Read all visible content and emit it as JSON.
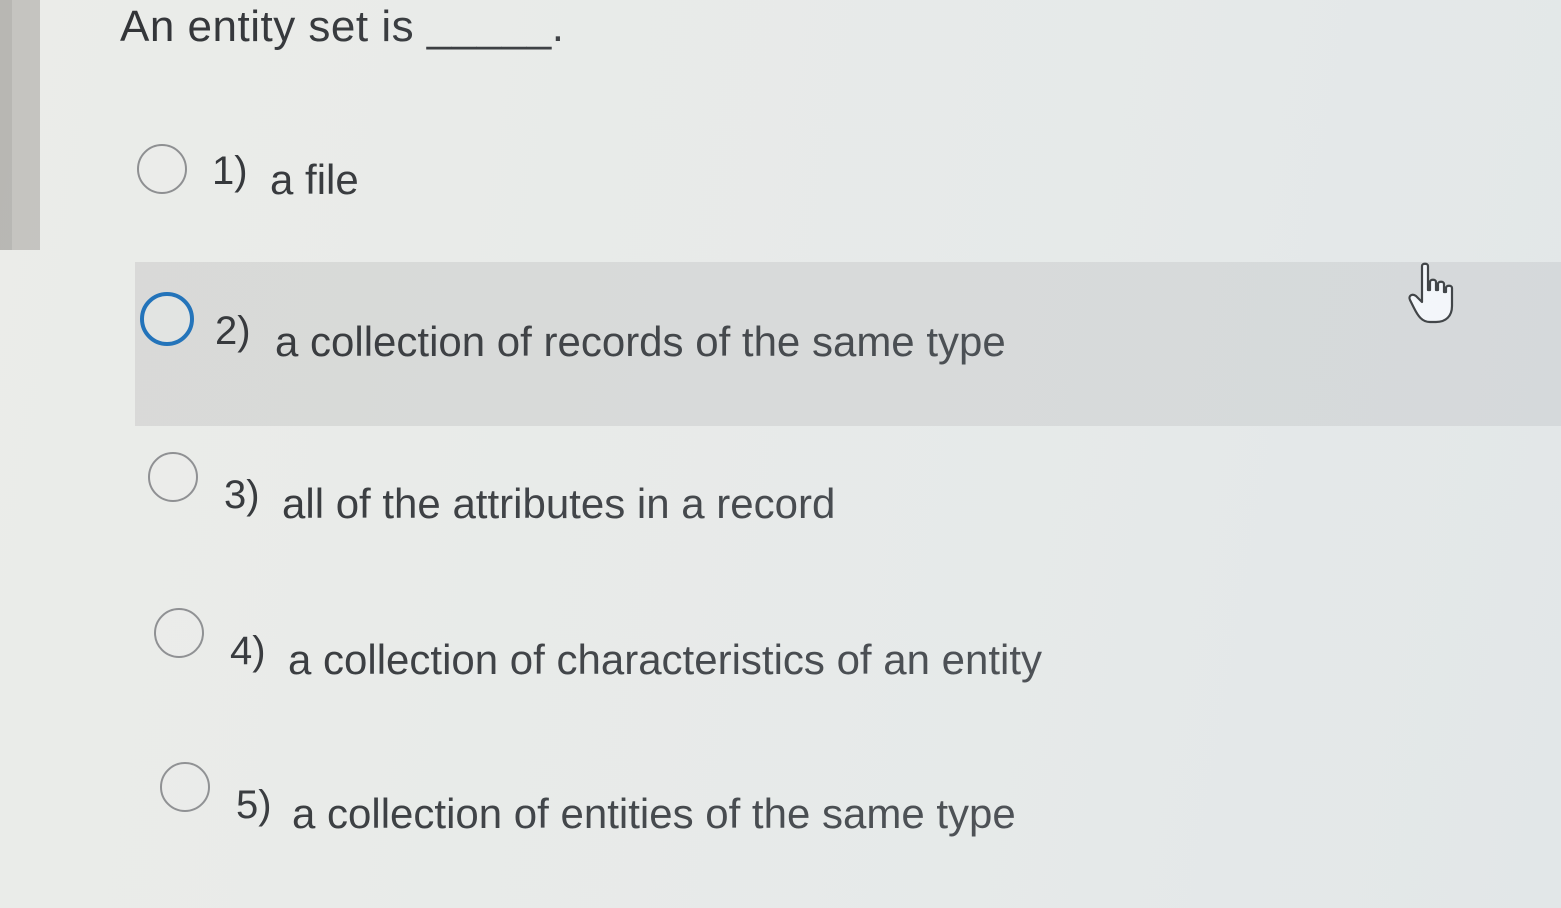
{
  "question": {
    "text": "An entity set is _____."
  },
  "options": [
    {
      "number": "1)",
      "text": "a file"
    },
    {
      "number": "2)",
      "text": "a collection of records of the same type"
    },
    {
      "number": "3)",
      "text": "all of the attributes in a record"
    },
    {
      "number": "4)",
      "text": "a collection of characteristics of an entity"
    },
    {
      "number": "5)",
      "text": "a collection of entities of the same type"
    }
  ],
  "hovered_option": 2,
  "focus_ring_color": "#1c6fb8",
  "cursor_icon": "hand-pointer-icon"
}
